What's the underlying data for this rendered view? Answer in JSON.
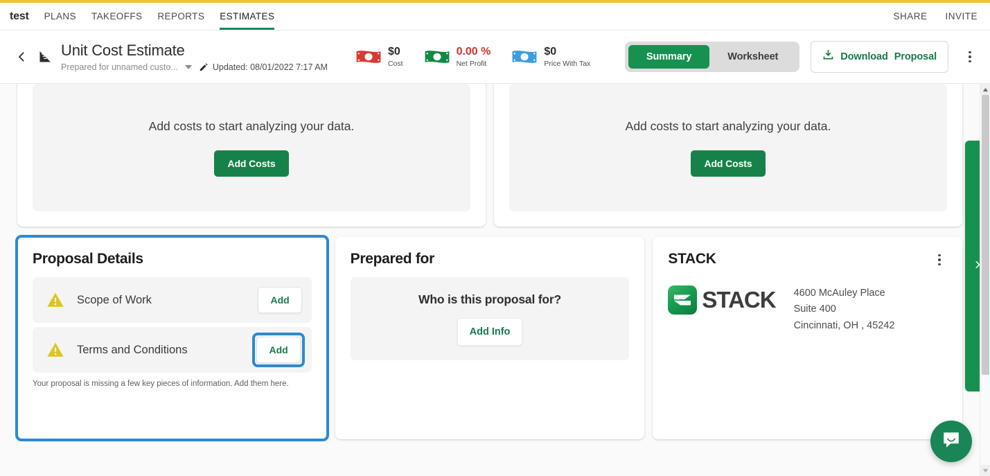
{
  "topnav": {
    "brand": "test",
    "items": [
      {
        "label": "PLANS",
        "active": false
      },
      {
        "label": "TAKEOFFS",
        "active": false
      },
      {
        "label": "REPORTS",
        "active": false
      },
      {
        "label": "ESTIMATES",
        "active": true
      }
    ],
    "right": [
      {
        "label": "SHARE"
      },
      {
        "label": "INVITE"
      }
    ],
    "accent_color": "#f2c230",
    "active_underline_color": "#1a8a5a"
  },
  "header": {
    "back_icon": "back-chevron-icon",
    "doc_icon": "ruler-triangle-icon",
    "title": "Unit Cost Estimate",
    "prepared_for": "Prepared for unnamed custo...",
    "edit_icon": "pencil-icon",
    "updated": "Updated: 08/01/2022 7:17 AM",
    "metrics": [
      {
        "icon": "money-bill-icon",
        "color": "#d93a32",
        "value": "$0",
        "label": "Cost",
        "value_color": "#2d2d2d"
      },
      {
        "icon": "money-bill-icon",
        "color": "#0f8a44",
        "value": "0.00 %",
        "label": "Net Profit",
        "value_color": "#d0342c"
      },
      {
        "icon": "money-bill-icon",
        "color": "#3c9ee0",
        "value": "$0",
        "label": "Price With Tax",
        "value_color": "#2d2d2d"
      }
    ],
    "view_toggle": {
      "options": [
        "Summary",
        "Worksheet"
      ],
      "selected": "Summary",
      "active_color": "#17914f"
    },
    "download_button": {
      "icon": "download-icon",
      "label_1": "Download",
      "label_2": "Proposal",
      "color": "#17794a"
    },
    "overflow_icon": "kebab-menu-icon"
  },
  "main": {
    "analytics_cards": [
      {
        "empty_text": "Add costs to start analyzing your data.",
        "button_label": "Add Costs"
      },
      {
        "empty_text": "Add costs to start analyzing your data.",
        "button_label": "Add Costs"
      }
    ],
    "proposal_details": {
      "title": "Proposal Details",
      "highlighted": true,
      "highlight_color": "#2a8bd4",
      "rows": [
        {
          "icon": "warning-triangle-icon",
          "label": "Scope of Work",
          "button_label": "Add",
          "button_focused": false
        },
        {
          "icon": "warning-triangle-icon",
          "label": "Terms and Conditions",
          "button_label": "Add",
          "button_focused": true
        }
      ],
      "hint": "Your proposal is missing a few key pieces of information. Add them here."
    },
    "prepared_for": {
      "title": "Prepared for",
      "question": "Who is this proposal for?",
      "button_label": "Add Info"
    },
    "company": {
      "title": "STACK",
      "overflow_icon": "kebab-menu-icon",
      "logo_icon": "stack-logo-icon",
      "logo_word": "STACK",
      "address_line_1": "4600 McAuley Place",
      "address_line_2": "Suite 400",
      "address_line_3": "Cincinnati, OH , 45242"
    }
  },
  "chrome": {
    "side_tab_icon": "chevron-right-icon",
    "side_tab_color": "#17914f",
    "scroll_up_icon": "scroll-up-arrow-icon",
    "scroll_down_icon": "scroll-down-arrow-icon",
    "chat_icon": "chat-bubble-icon"
  }
}
